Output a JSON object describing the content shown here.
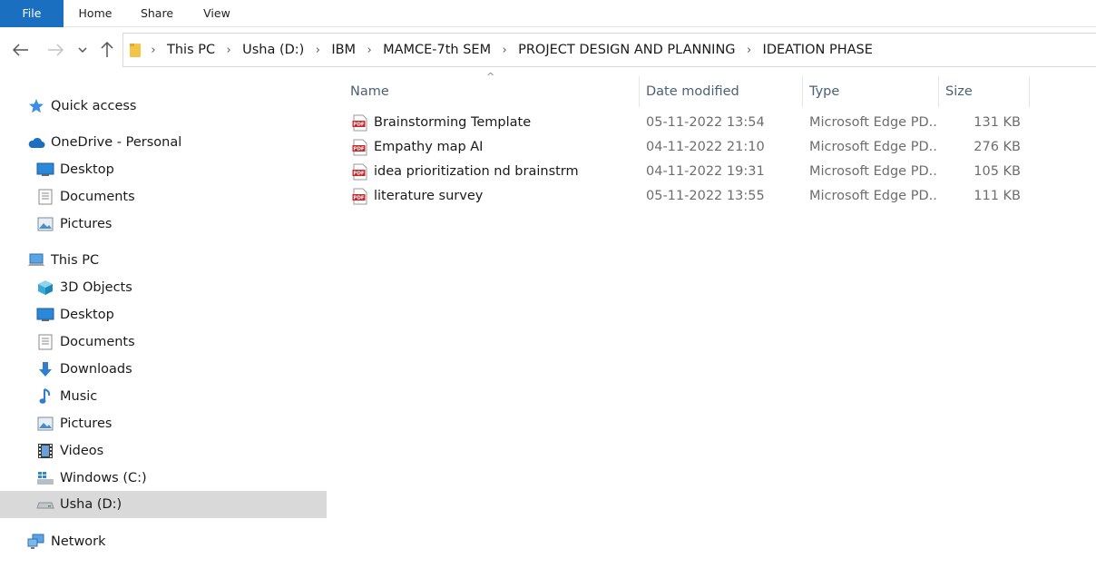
{
  "ribbon": {
    "tabs": [
      "File",
      "Home",
      "Share",
      "View"
    ]
  },
  "nav": {
    "back_icon": "←",
    "forward_icon": "→",
    "recent_icon": "⌄",
    "up_icon": "↑"
  },
  "address": {
    "crumbs": [
      "This PC",
      "Usha (D:)",
      "IBM",
      "MAMCE-7th SEM",
      "PROJECT DESIGN AND PLANNING",
      "IDEATION PHASE"
    ],
    "separator": "›"
  },
  "sidebar": {
    "items": [
      {
        "label": "Quick access",
        "icon": "star-icon"
      },
      {
        "label": "OneDrive - Personal",
        "icon": "cloud-icon"
      },
      {
        "label": "Desktop",
        "icon": "desktop-icon"
      },
      {
        "label": "Documents",
        "icon": "documents-icon"
      },
      {
        "label": "Pictures",
        "icon": "pictures-icon"
      },
      {
        "label": "This PC",
        "icon": "computer-icon"
      },
      {
        "label": "3D Objects",
        "icon": "cube-icon"
      },
      {
        "label": "Desktop",
        "icon": "desktop-icon"
      },
      {
        "label": "Documents",
        "icon": "documents-icon"
      },
      {
        "label": "Downloads",
        "icon": "download-icon"
      },
      {
        "label": "Music",
        "icon": "music-icon"
      },
      {
        "label": "Pictures",
        "icon": "pictures-icon"
      },
      {
        "label": "Videos",
        "icon": "videos-icon"
      },
      {
        "label": "Windows (C:)",
        "icon": "windows-drive-icon"
      },
      {
        "label": "Usha (D:)",
        "icon": "drive-icon"
      },
      {
        "label": "Network",
        "icon": "network-icon"
      }
    ],
    "selected": "Usha (D:)"
  },
  "columns": {
    "name": "Name",
    "date": "Date modified",
    "type": "Type",
    "size": "Size",
    "sort_icon": "^"
  },
  "files": [
    {
      "name": "Brainstorming Template",
      "date": "05-11-2022 13:54",
      "type": "Microsoft Edge PD...",
      "size": "131 KB"
    },
    {
      "name": "Empathy map AI",
      "date": "04-11-2022 21:10",
      "type": "Microsoft Edge PD...",
      "size": "276 KB"
    },
    {
      "name": "idea prioritization nd brainstrm",
      "date": "04-11-2022 19:31",
      "type": "Microsoft Edge PD...",
      "size": "105 KB"
    },
    {
      "name": "literature survey",
      "date": "05-11-2022 13:55",
      "type": "Microsoft Edge PD...",
      "size": "111 KB"
    }
  ],
  "colors": {
    "accent": "#1a6fc0",
    "selected_bg": "#d9d9d9",
    "pdf_red": "#c8262b"
  }
}
